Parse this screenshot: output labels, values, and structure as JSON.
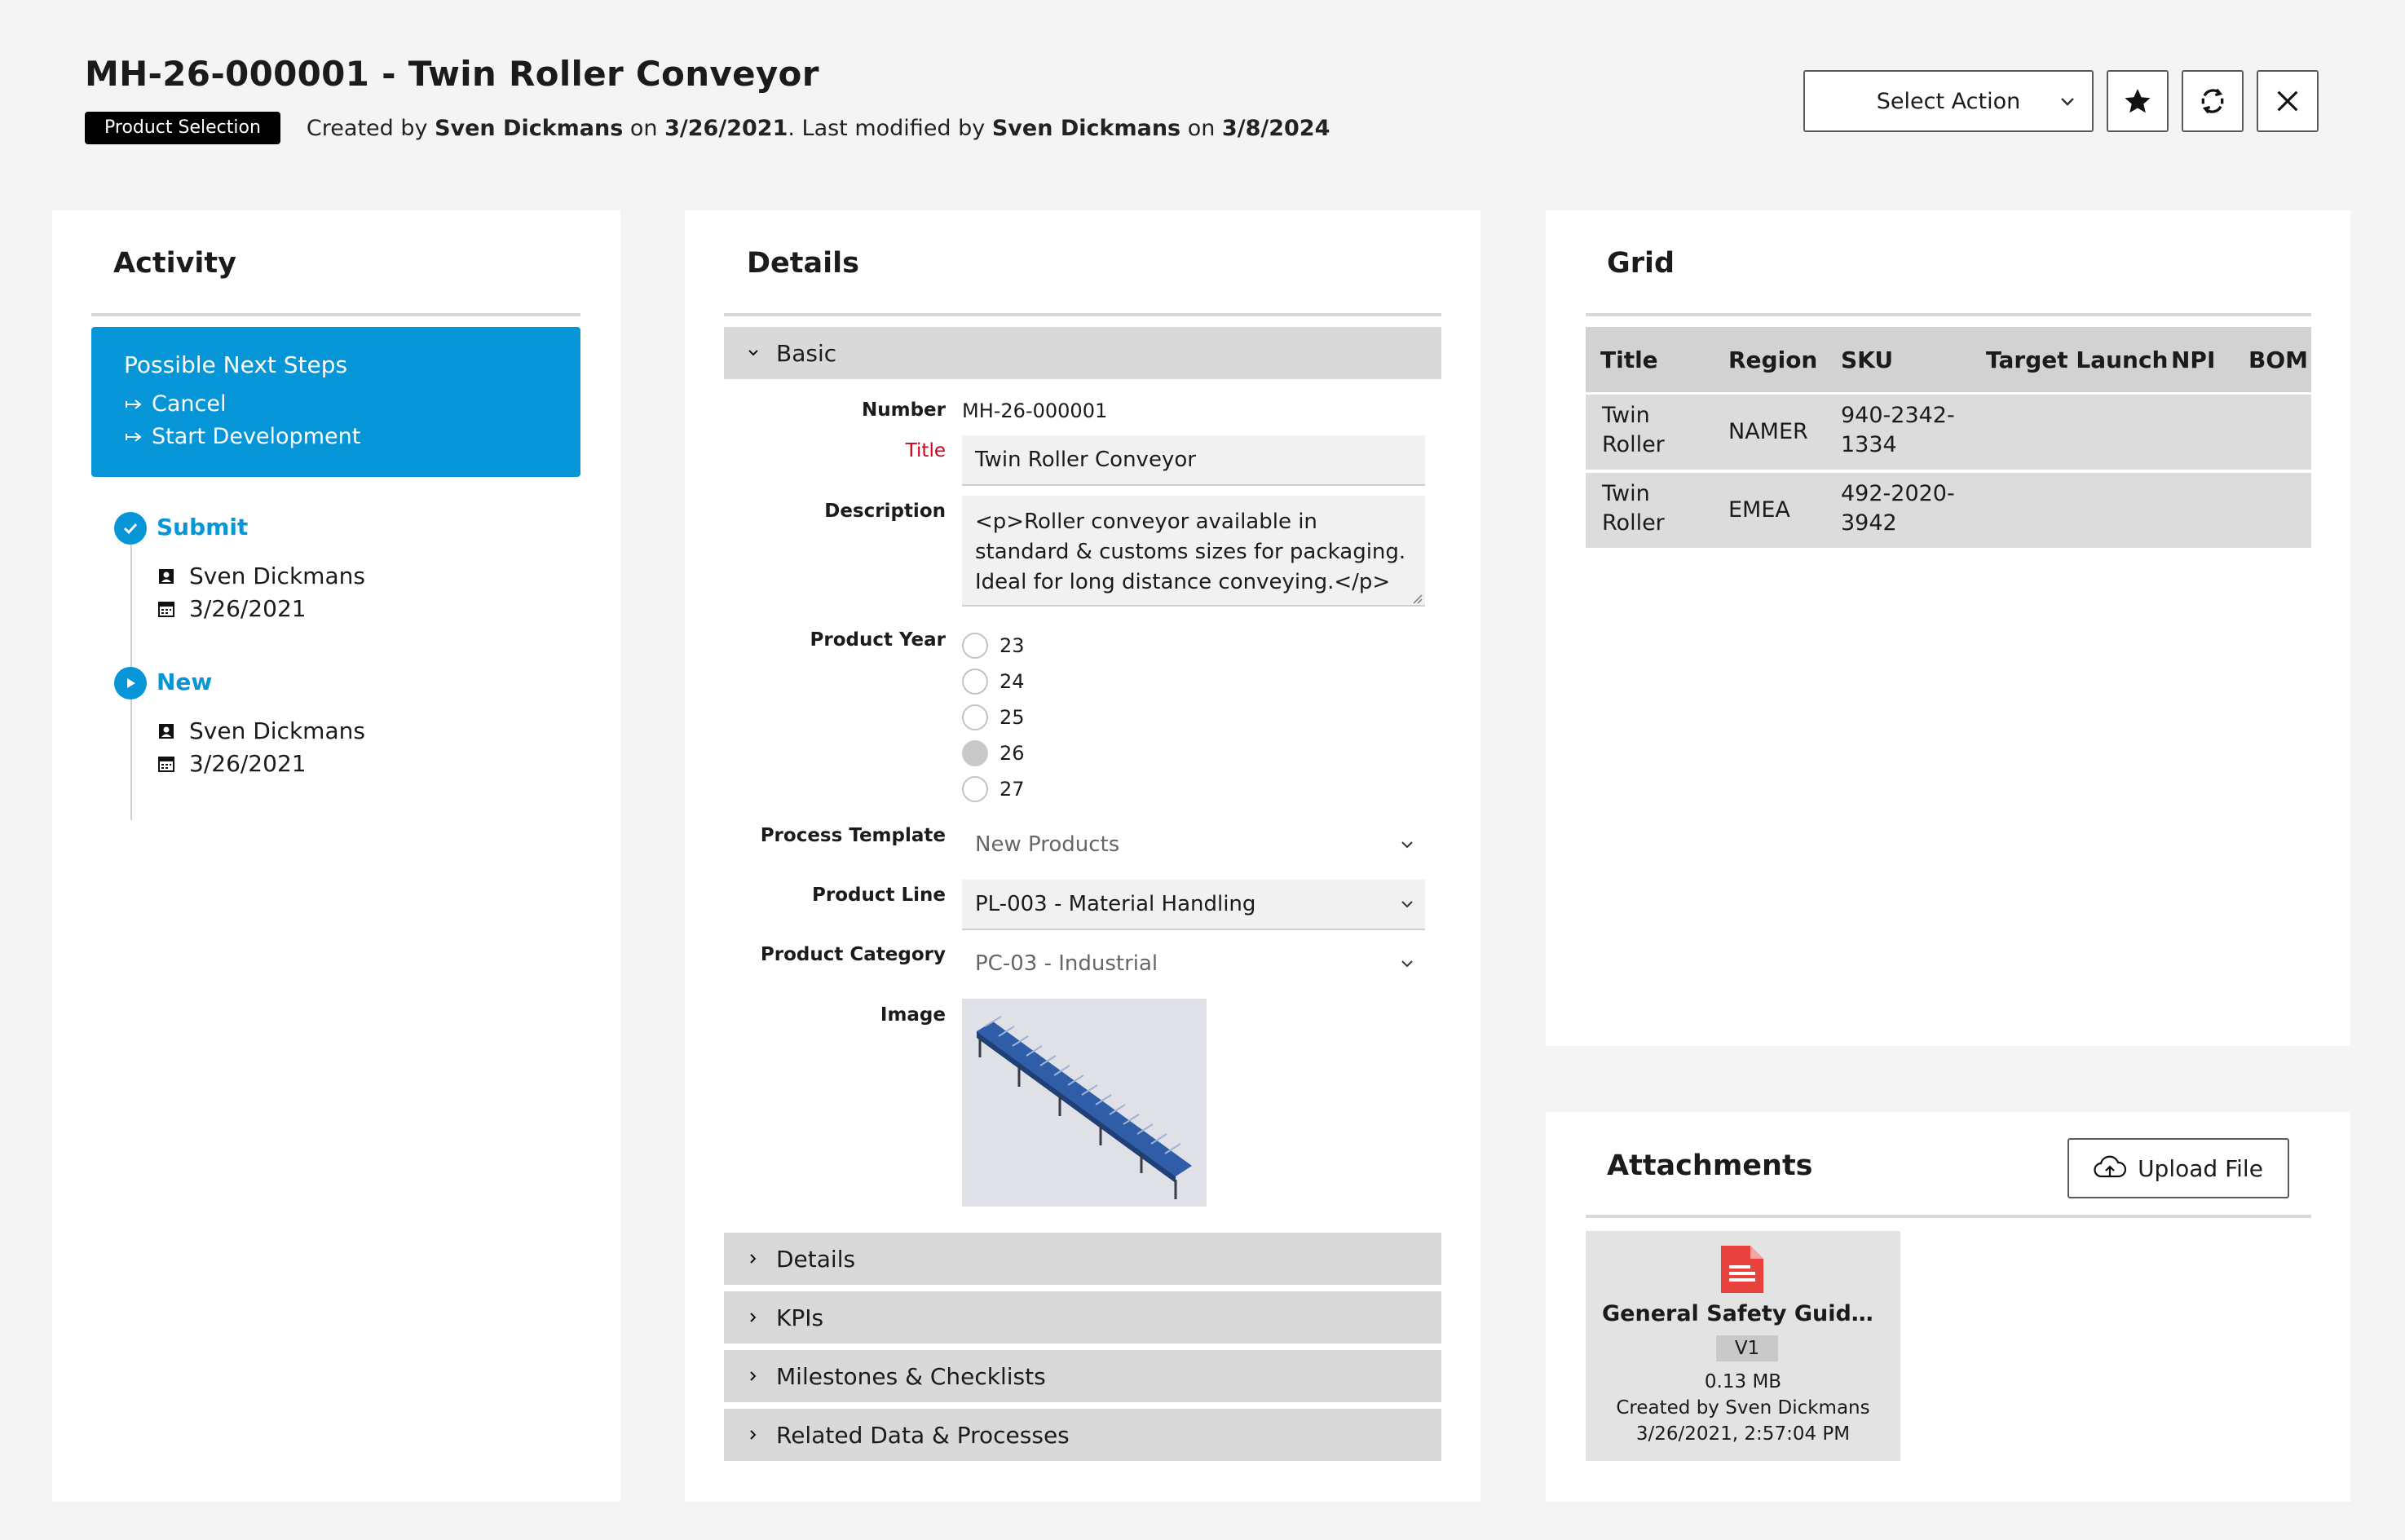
{
  "header": {
    "title": "MH-26-000001 - Twin Roller Conveyor",
    "badge": "Product Selection",
    "created_prefix": "Created by ",
    "created_by": "Sven Dickmans",
    "created_on_prefix": " on ",
    "created_on": "3/26/2021",
    "modified_prefix": ". Last modified by ",
    "modified_by": "Sven Dickmans",
    "modified_on_prefix": " on ",
    "modified_on": "3/8/2024",
    "select_action": "Select Action"
  },
  "activity": {
    "title": "Activity",
    "next_steps_title": "Possible Next Steps",
    "next_steps": [
      "Cancel",
      "Start Development"
    ],
    "timeline": [
      {
        "label": "Submit",
        "user": "Sven Dickmans",
        "date": "3/26/2021"
      },
      {
        "label": "New",
        "user": "Sven Dickmans",
        "date": "3/26/2021"
      }
    ]
  },
  "details": {
    "title": "Details",
    "sections": {
      "basic": "Basic",
      "details": "Details",
      "kpis": "KPIs",
      "milestones": "Milestones & Checklists",
      "related": "Related Data & Processes"
    },
    "labels": {
      "number": "Number",
      "title": "Title",
      "description": "Description",
      "product_year": "Product Year",
      "process_template": "Process Template",
      "product_line": "Product Line",
      "product_category": "Product Category",
      "image": "Image"
    },
    "values": {
      "number": "MH-26-000001",
      "title": "Twin Roller Conveyor",
      "description": "<p>Roller conveyor available in standard & customs sizes for packaging. Ideal for long distance conveying.</p><p>",
      "product_year_options": [
        "23",
        "24",
        "25",
        "26",
        "27"
      ],
      "product_year_selected": "26",
      "process_template": "New Products",
      "product_line": "PL-003 - Material Handling",
      "product_category": "PC-03 - Industrial"
    }
  },
  "grid": {
    "title": "Grid",
    "columns": [
      "Title",
      "Region",
      "SKU",
      "Target Launch",
      "NPI",
      "BOM"
    ],
    "rows": [
      {
        "title_1": "Twin",
        "title_2": "Roller",
        "region": "NAMER",
        "sku_1": "940-2342-",
        "sku_2": "1334"
      },
      {
        "title_1": "Twin",
        "title_2": "Roller",
        "region": "EMEA",
        "sku_1": "492-2020-",
        "sku_2": "3942"
      }
    ]
  },
  "attachments": {
    "title": "Attachments",
    "upload_label": "Upload File",
    "file": {
      "name": "General Safety Guideli…",
      "version": "V1",
      "size": "0.13 MB",
      "created_by": "Created by Sven Dickmans",
      "created_at": "3/26/2021, 2:57:04 PM"
    }
  }
}
